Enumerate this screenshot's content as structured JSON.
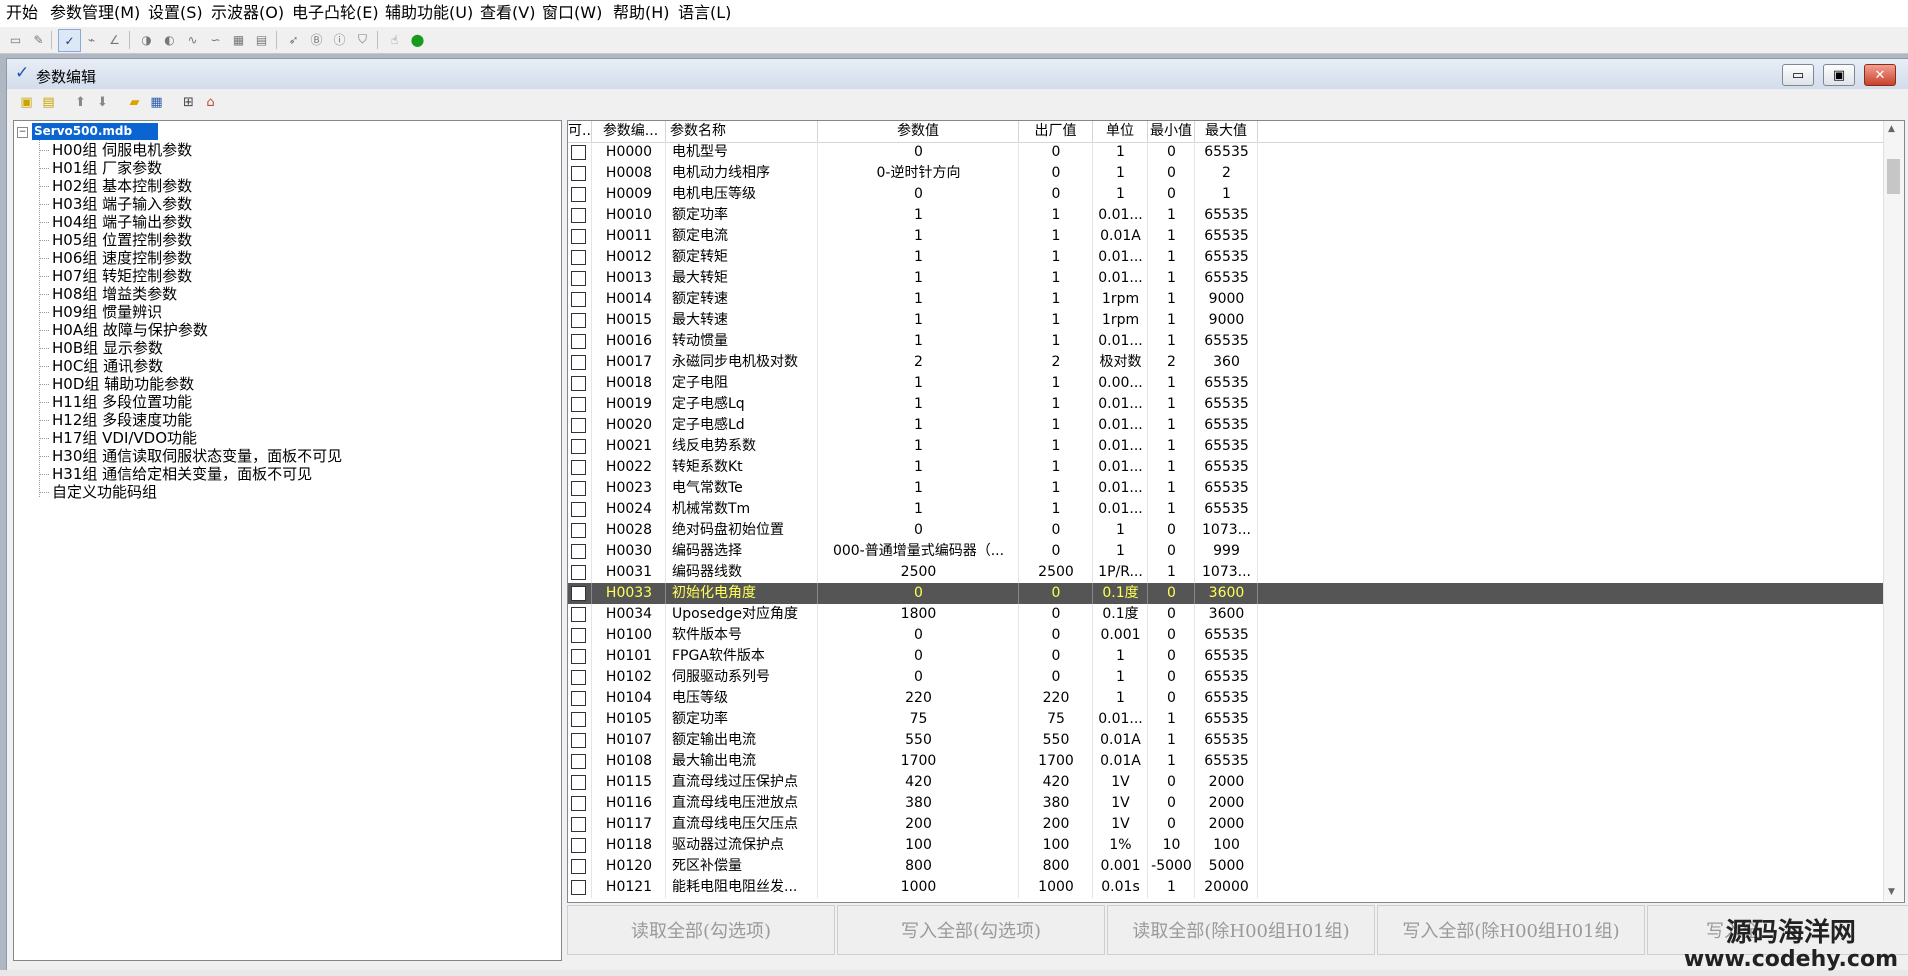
{
  "menu": [
    "开始",
    "参数管理(M)",
    "设置(S)",
    "示波器(O)",
    "电子凸轮(E)",
    "辅助功能(U)",
    "查看(V)",
    "窗口(W)",
    "帮助(H)",
    "语言(L)"
  ],
  "window": {
    "title": "参数编辑",
    "minimize_glyph": "▭",
    "restore_glyph": "▣",
    "close_glyph": "✕"
  },
  "tree": {
    "root": "Servo500.mdb",
    "groups": [
      "H00组 伺服电机参数",
      "H01组 厂家参数",
      "H02组 基本控制参数",
      "H03组 端子输入参数",
      "H04组 端子输出参数",
      "H05组 位置控制参数",
      "H06组 速度控制参数",
      "H07组 转矩控制参数",
      "H08组 增益类参数",
      "H09组 惯量辨识",
      "H0A组 故障与保护参数",
      "H0B组 显示参数",
      "H0C组 通讯参数",
      "H0D组 辅助功能参数",
      "H11组 多段位置功能",
      "H12组 多段速度功能",
      "H17组 VDI/VDO功能",
      "H30组 通信读取伺服状态变量，面板不可见",
      "H31组 通信给定相关变量，面板不可见",
      "自定义功能码组"
    ]
  },
  "table": {
    "columns": [
      "可...",
      "参数编...",
      "参数名称",
      "参数值",
      "出厂值",
      "单位",
      "最小值",
      "最大值"
    ],
    "selected_row": 21,
    "rows": [
      [
        "H0000",
        "电机型号",
        "0",
        "0",
        "1",
        "0",
        "65535"
      ],
      [
        "H0008",
        "电机动力线相序",
        "0-逆时针方向",
        "0",
        "1",
        "0",
        "2"
      ],
      [
        "H0009",
        "电机电压等级",
        "0",
        "0",
        "1",
        "0",
        "1"
      ],
      [
        "H0010",
        "额定功率",
        "1",
        "1",
        "0.01...",
        "1",
        "65535"
      ],
      [
        "H0011",
        "额定电流",
        "1",
        "1",
        "0.01A",
        "1",
        "65535"
      ],
      [
        "H0012",
        "额定转矩",
        "1",
        "1",
        "0.01...",
        "1",
        "65535"
      ],
      [
        "H0013",
        "最大转矩",
        "1",
        "1",
        "0.01...",
        "1",
        "65535"
      ],
      [
        "H0014",
        "额定转速",
        "1",
        "1",
        "1rpm",
        "1",
        "9000"
      ],
      [
        "H0015",
        "最大转速",
        "1",
        "1",
        "1rpm",
        "1",
        "9000"
      ],
      [
        "H0016",
        "转动惯量",
        "1",
        "1",
        "0.01...",
        "1",
        "65535"
      ],
      [
        "H0017",
        "永磁同步电机极对数",
        "2",
        "2",
        "极对数",
        "2",
        "360"
      ],
      [
        "H0018",
        "定子电阻",
        "1",
        "1",
        "0.00...",
        "1",
        "65535"
      ],
      [
        "H0019",
        "定子电感Lq",
        "1",
        "1",
        "0.01...",
        "1",
        "65535"
      ],
      [
        "H0020",
        "定子电感Ld",
        "1",
        "1",
        "0.01...",
        "1",
        "65535"
      ],
      [
        "H0021",
        "线反电势系数",
        "1",
        "1",
        "0.01...",
        "1",
        "65535"
      ],
      [
        "H0022",
        "转矩系数Kt",
        "1",
        "1",
        "0.01...",
        "1",
        "65535"
      ],
      [
        "H0023",
        "电气常数Te",
        "1",
        "1",
        "0.01...",
        "1",
        "65535"
      ],
      [
        "H0024",
        "机械常数Tm",
        "1",
        "1",
        "0.01...",
        "1",
        "65535"
      ],
      [
        "H0028",
        "绝对码盘初始位置",
        "0",
        "0",
        "1",
        "0",
        "1073..."
      ],
      [
        "H0030",
        "编码器选择",
        "000-普通增量式编码器（...",
        "0",
        "1",
        "0",
        "999"
      ],
      [
        "H0031",
        "编码器线数",
        "2500",
        "2500",
        "1P/R...",
        "1",
        "1073..."
      ],
      [
        "H0033",
        "初始化电角度",
        "0",
        "0",
        "0.1度",
        "0",
        "3600"
      ],
      [
        "H0034",
        "Uposedge对应角度",
        "1800",
        "0",
        "0.1度",
        "0",
        "3600"
      ],
      [
        "H0100",
        "软件版本号",
        "0",
        "0",
        "0.001",
        "0",
        "65535"
      ],
      [
        "H0101",
        "FPGA软件版本",
        "0",
        "0",
        "1",
        "0",
        "65535"
      ],
      [
        "H0102",
        "伺服驱动系列号",
        "0",
        "0",
        "1",
        "0",
        "65535"
      ],
      [
        "H0104",
        "电压等级",
        "220",
        "220",
        "1",
        "0",
        "65535"
      ],
      [
        "H0105",
        "额定功率",
        "75",
        "75",
        "0.01...",
        "1",
        "65535"
      ],
      [
        "H0107",
        "额定输出电流",
        "550",
        "550",
        "0.01A",
        "1",
        "65535"
      ],
      [
        "H0108",
        "最大输出电流",
        "1700",
        "1700",
        "0.01A",
        "1",
        "65535"
      ],
      [
        "H0115",
        "直流母线过压保护点",
        "420",
        "420",
        "1V",
        "0",
        "2000"
      ],
      [
        "H0116",
        "直流母线电压泄放点",
        "380",
        "380",
        "1V",
        "0",
        "2000"
      ],
      [
        "H0117",
        "直流母线电压欠压点",
        "200",
        "200",
        "1V",
        "0",
        "2000"
      ],
      [
        "H0118",
        "驱动器过流保护点",
        "100",
        "100",
        "1%",
        "10",
        "100"
      ],
      [
        "H0120",
        "死区补偿量",
        "800",
        "800",
        "0.001",
        "-5000",
        "5000"
      ],
      [
        "H0121",
        "能耗电阻电阻丝发...",
        "1000",
        "1000",
        "0.01s",
        "1",
        "20000"
      ]
    ]
  },
  "buttons": [
    "读取全部(勾选项)",
    "写入全部(勾选项)",
    "读取全部(除H00组H01组)",
    "写入全部(除H00组H01组)",
    "写入全"
  ],
  "watermark": {
    "name": "源码海洋网",
    "url": "www.codehy.com"
  }
}
